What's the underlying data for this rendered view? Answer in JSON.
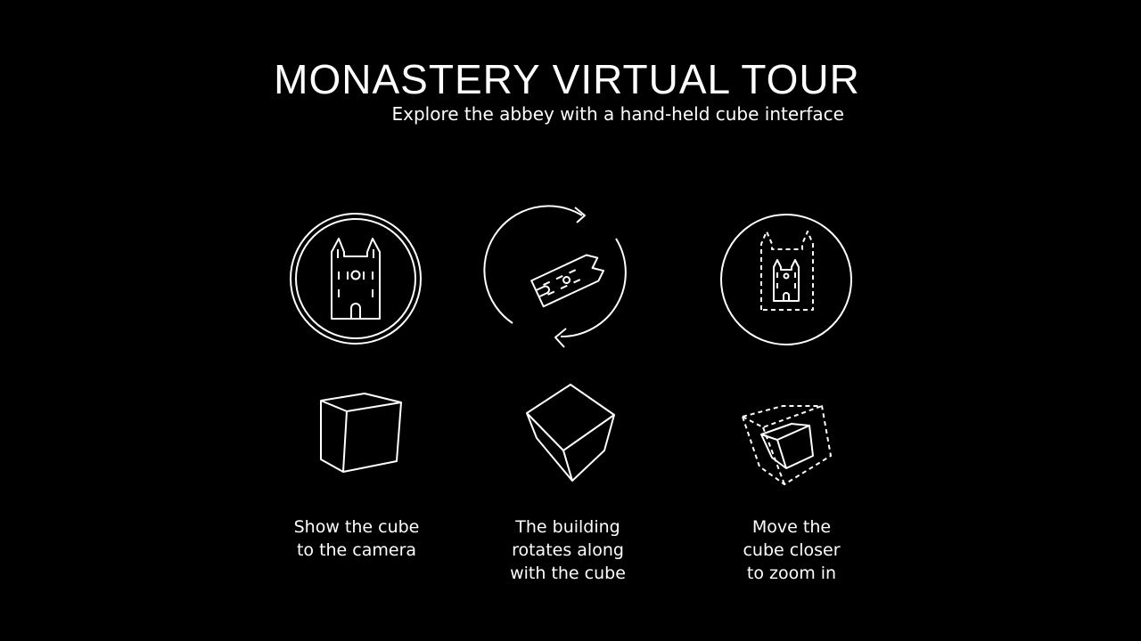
{
  "header": {
    "title": "MONASTERY VIRTUAL TOUR",
    "subtitle": "Explore the abbey with a hand-held cube interface"
  },
  "steps": [
    {
      "icon": "abbey-in-circle-icon",
      "cube_icon": "cube-icon",
      "caption_lines": [
        "Show the cube",
        "to the camera"
      ]
    },
    {
      "icon": "rotating-building-icon",
      "cube_icon": "tilted-cube-icon",
      "caption_lines": [
        "The building",
        "rotates along",
        "with the cube"
      ]
    },
    {
      "icon": "zoom-abbey-icon",
      "cube_icon": "cube-zoom-icon",
      "caption_lines": [
        "Move the",
        "cube closer",
        "to zoom in"
      ]
    }
  ],
  "colors": {
    "background": "#000000",
    "foreground": "#ffffff"
  }
}
